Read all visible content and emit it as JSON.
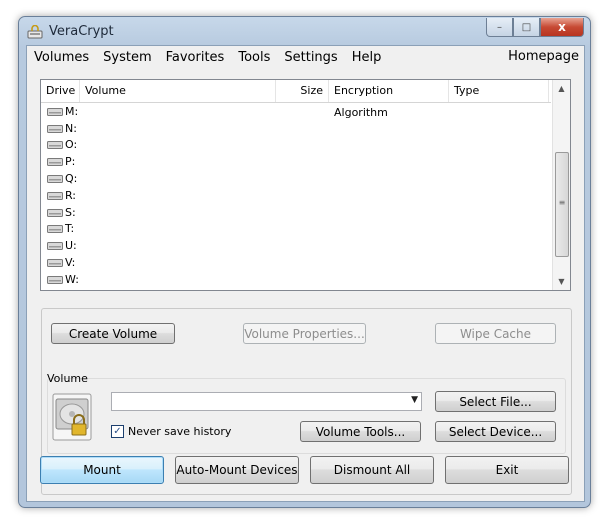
{
  "window": {
    "title": "VeraCrypt",
    "controls": {
      "minimize": "–",
      "maximize": "□",
      "close": "x"
    }
  },
  "menu": {
    "items": [
      "Volumes",
      "System",
      "Favorites",
      "Tools",
      "Settings",
      "Help"
    ],
    "homepage": "Homepage"
  },
  "table": {
    "columns": [
      "Drive",
      "Volume",
      "Size",
      "Encryption Algorithm",
      "Type"
    ],
    "rows": [
      "M:",
      "N:",
      "O:",
      "P:",
      "Q:",
      "R:",
      "S:",
      "T:",
      "U:",
      "V:",
      "W:"
    ]
  },
  "actions": {
    "create_volume": "Create Volume",
    "volume_properties": "Volume Properties...",
    "wipe_cache": "Wipe Cache"
  },
  "volume": {
    "group_label": "Volume",
    "path_value": "",
    "never_save_history": "Never save history",
    "never_save_history_checked": true,
    "select_file": "Select File...",
    "volume_tools": "Volume Tools...",
    "select_device": "Select Device..."
  },
  "bottom": {
    "mount": "Mount",
    "auto_mount": "Auto-Mount Devices",
    "dismount_all": "Dismount All",
    "exit": "Exit"
  },
  "icons": {
    "app": "veracrypt-app-icon",
    "drive": "drive-icon",
    "disk": "disk-lock-icon",
    "scroll_up": "chevron-up-icon",
    "scroll_down": "chevron-down-icon",
    "dropdown": "chevron-down-icon"
  }
}
